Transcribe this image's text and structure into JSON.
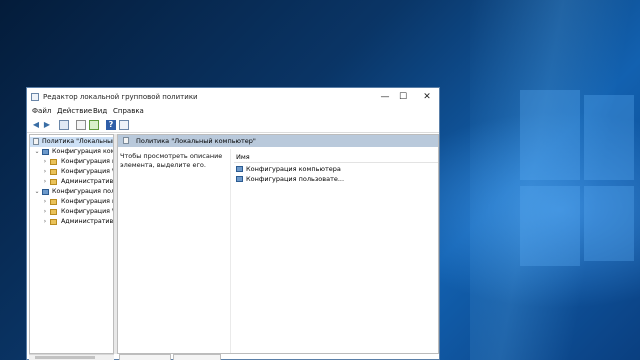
{
  "window": {
    "title": "Редактор локальной групповой политики",
    "controls": {
      "minimize": "—",
      "maximize": "☐",
      "close": "✕"
    }
  },
  "menu": {
    "file": "Файл",
    "action": "Действие",
    "view": "Вид",
    "help": "Справка"
  },
  "toolbar": {
    "icons": [
      "back-arrow-icon",
      "forward-arrow-icon",
      "show-hide-tree-icon",
      "properties-icon",
      "export-list-icon",
      "help-icon",
      "extended-view-icon"
    ]
  },
  "tree": {
    "items": [
      {
        "label": "Политика \"Локальный",
        "icon": "document",
        "expanded": true
      },
      {
        "label": "Конфигурация компь",
        "icon": "computer",
        "expanded": true
      },
      {
        "label": "Конфигурация п",
        "icon": "folder",
        "expanded": false
      },
      {
        "label": "Конфигурация W",
        "icon": "folder",
        "expanded": false
      },
      {
        "label": "Административн",
        "icon": "folder",
        "expanded": false
      },
      {
        "label": "Конфигурация поль",
        "icon": "computer",
        "expanded": true
      },
      {
        "label": "Конфигурация п",
        "icon": "folder",
        "expanded": false
      },
      {
        "label": "Конфигурация W",
        "icon": "folder",
        "expanded": false
      },
      {
        "label": "Административн",
        "icon": "folder",
        "expanded": false
      }
    ]
  },
  "details": {
    "header": "Политика \"Локальный компьютер\"",
    "description": "Чтобы просмотреть описание элемента, выделите его.",
    "column_name": "Имя",
    "rows": [
      "Конфигурация компьютера",
      "Конфигурация пользовате..."
    ]
  }
}
